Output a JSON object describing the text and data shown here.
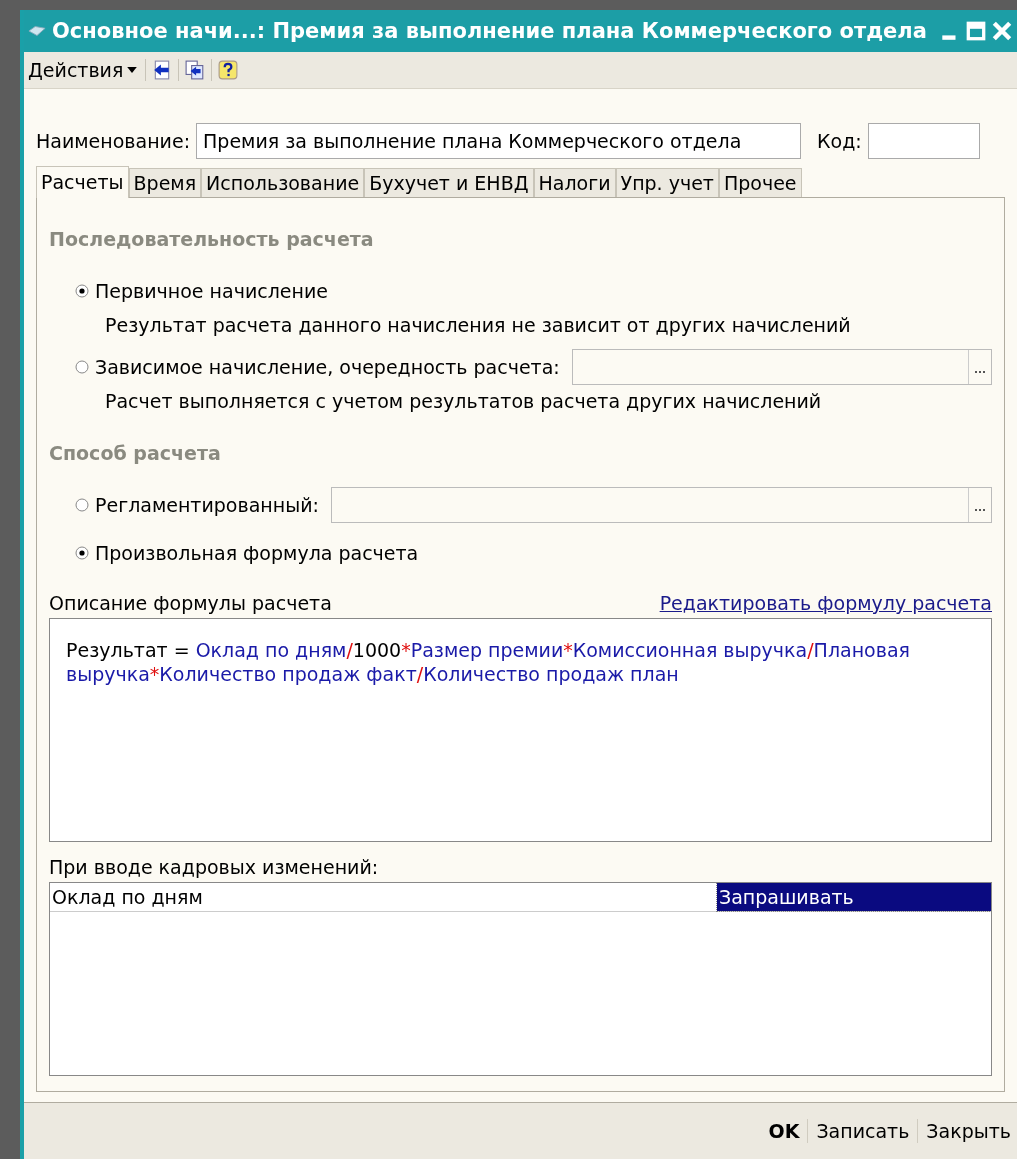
{
  "window": {
    "title": "Основное начи...: Премия за выполнение плана Коммерческого отдела"
  },
  "toolbar": {
    "actions_menu": "Действия"
  },
  "name_field": {
    "label": "Наименование:",
    "value": "Премия за выполнение плана Коммерческого отдела"
  },
  "code_field": {
    "label": "Код:"
  },
  "tabs": [
    {
      "label": "Расчеты",
      "selected": true
    },
    {
      "label": "Время",
      "selected": false
    },
    {
      "label": "Использование",
      "selected": false
    },
    {
      "label": "Бухучет и ЕНВД",
      "selected": false
    },
    {
      "label": "Налоги",
      "selected": false
    },
    {
      "label": "Упр. учет",
      "selected": false
    },
    {
      "label": "Прочее",
      "selected": false
    }
  ],
  "sequence_section": {
    "heading": "Последовательность расчета",
    "options": [
      {
        "label": "Первичное начисление",
        "selected": true,
        "has_field": false,
        "description": "Результат расчета данного начисления не зависит от других начислений"
      },
      {
        "label": "Зависимое начисление, очередность расчета:",
        "selected": false,
        "has_field": true,
        "description": "Расчет выполняется с учетом результатов расчета других начислений"
      }
    ]
  },
  "method_section": {
    "heading": "Способ расчета",
    "options": [
      {
        "label": "Регламентированный:",
        "selected": false,
        "has_field": true
      },
      {
        "label": "Произвольная формула расчета",
        "selected": true,
        "has_field": false
      }
    ]
  },
  "formula": {
    "label": "Описание формулы расчета",
    "edit_link": "Редактировать формулу расчета",
    "segments": [
      {
        "kind": "text",
        "text": "Результат = "
      },
      {
        "kind": "field",
        "text": "Оклад по дням"
      },
      {
        "kind": "op",
        "text": "/"
      },
      {
        "kind": "text",
        "text": "1000"
      },
      {
        "kind": "op",
        "text": "*"
      },
      {
        "kind": "field",
        "text": "Размер премии"
      },
      {
        "kind": "op",
        "text": "*"
      },
      {
        "kind": "field",
        "text": "Комиссионная выручка"
      },
      {
        "kind": "op",
        "text": "/"
      },
      {
        "kind": "field",
        "text": "Плановая выручка"
      },
      {
        "kind": "op",
        "text": "*"
      },
      {
        "kind": "field",
        "text": "Количество продаж факт"
      },
      {
        "kind": "op",
        "text": "/"
      },
      {
        "kind": "field",
        "text": "Количество продаж план"
      }
    ]
  },
  "personnel_changes": {
    "label": "При вводе кадровых изменений:",
    "rows": [
      {
        "name": "Оклад по дням",
        "action": "Запрашивать",
        "selected": true
      }
    ]
  },
  "buttons": [
    {
      "label": "OK",
      "default": true
    },
    {
      "label": "Записать",
      "default": false
    },
    {
      "label": "Закрыть",
      "default": false
    }
  ]
}
